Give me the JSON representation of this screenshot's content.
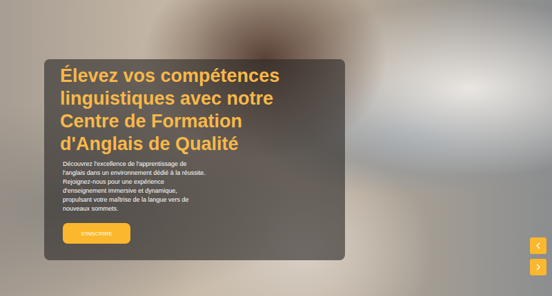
{
  "hero": {
    "heading": [
      "Élevez vos compétences",
      "linguistiques avec notre",
      "Centre de Formation",
      "d'Anglais de Qualité"
    ],
    "description": [
      "Découvrez l'excellence de l'apprentissage de",
      "l'anglais dans un environnement dédié à la réussite.",
      "Rejoignez-nous pour une expérience",
      "d'enseignement immersive et dynamique,",
      "propulsant votre maîtrise de la langue vers de",
      "nouveaux sommets."
    ],
    "cta": "S'INSCRIRE"
  }
}
